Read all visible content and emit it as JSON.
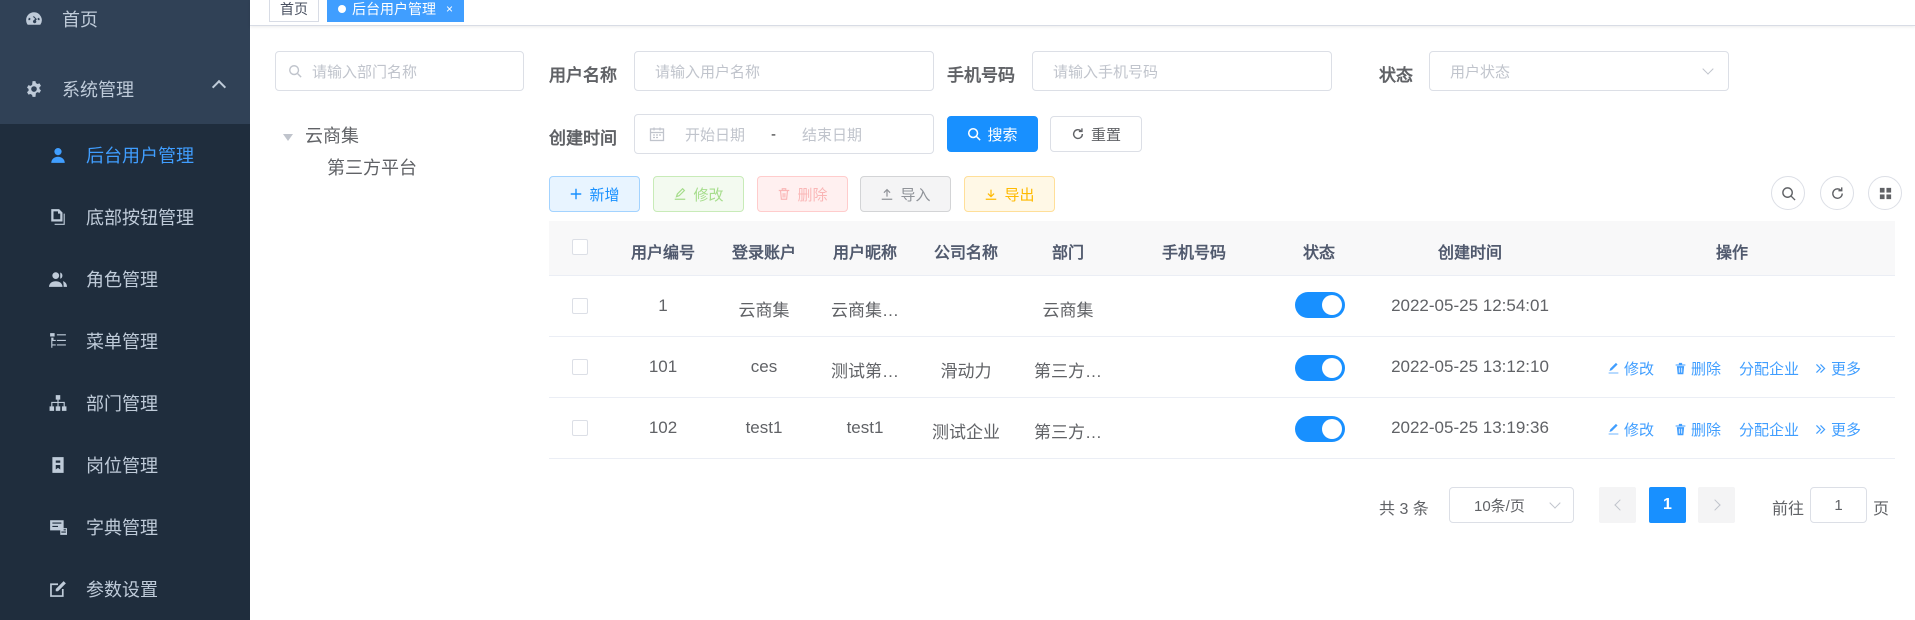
{
  "sidebar": {
    "home": "首页",
    "system": "系统管理",
    "items": [
      {
        "label": "后台用户管理",
        "icon": "user-icon"
      },
      {
        "label": "底部按钮管理",
        "icon": "document-copy-icon"
      },
      {
        "label": "角色管理",
        "icon": "peoples-icon"
      },
      {
        "label": "菜单管理",
        "icon": "tree-table-icon"
      },
      {
        "label": "部门管理",
        "icon": "tree-icon"
      },
      {
        "label": "岗位管理",
        "icon": "post-icon"
      },
      {
        "label": "字典管理",
        "icon": "dict-icon"
      },
      {
        "label": "参数设置",
        "icon": "edit-icon"
      }
    ]
  },
  "tabs": {
    "home": "首页",
    "active": "后台用户管理",
    "close": "×"
  },
  "dept_tree": {
    "search_placeholder": "请输入部门名称",
    "root": "云商集",
    "child": "第三方平台"
  },
  "filters": {
    "username_label": "用户名称",
    "username_placeholder": "请输入用户名称",
    "phone_label": "手机号码",
    "phone_placeholder": "请输入手机号码",
    "status_label": "状态",
    "status_placeholder": "用户状态",
    "created_label": "创建时间",
    "start_placeholder": "开始日期",
    "range_sep": "-",
    "end_placeholder": "结束日期",
    "search_btn": "搜索",
    "reset_btn": "重置"
  },
  "toolbar": {
    "add": "新增",
    "edit": "修改",
    "delete": "删除",
    "import": "导入",
    "export": "导出"
  },
  "table": {
    "headers": [
      "用户编号",
      "登录账户",
      "用户昵称",
      "公司名称",
      "部门",
      "手机号码",
      "状态",
      "创建时间",
      "操作"
    ],
    "rows": [
      {
        "id": "1",
        "account": "云商集",
        "nickname": "云商集…",
        "company": "",
        "dept": "云商集",
        "phone": "",
        "enabled": true,
        "created": "2022-05-25 12:54:01",
        "ops": false
      },
      {
        "id": "101",
        "account": "ces",
        "nickname": "测试第…",
        "company": "滑动力",
        "dept": "第三方…",
        "phone": "",
        "enabled": true,
        "created": "2022-05-25 13:12:10",
        "ops": true
      },
      {
        "id": "102",
        "account": "test1",
        "nickname": "test1",
        "company": "测试企业",
        "dept": "第三方…",
        "phone": "",
        "enabled": true,
        "created": "2022-05-25 13:19:36",
        "ops": true
      }
    ],
    "op_labels": {
      "edit": "修改",
      "delete": "删除",
      "assign": "分配企业",
      "more": "更多"
    }
  },
  "pagination": {
    "total": "共 3 条",
    "page_size": "10条/页",
    "current_page": "1",
    "goto_prefix": "前往",
    "goto_value": "1",
    "goto_suffix": "页"
  },
  "colors": {
    "sidebar_bg": "#304156",
    "primary": "#409eff",
    "switch_on": "#1890ff"
  }
}
